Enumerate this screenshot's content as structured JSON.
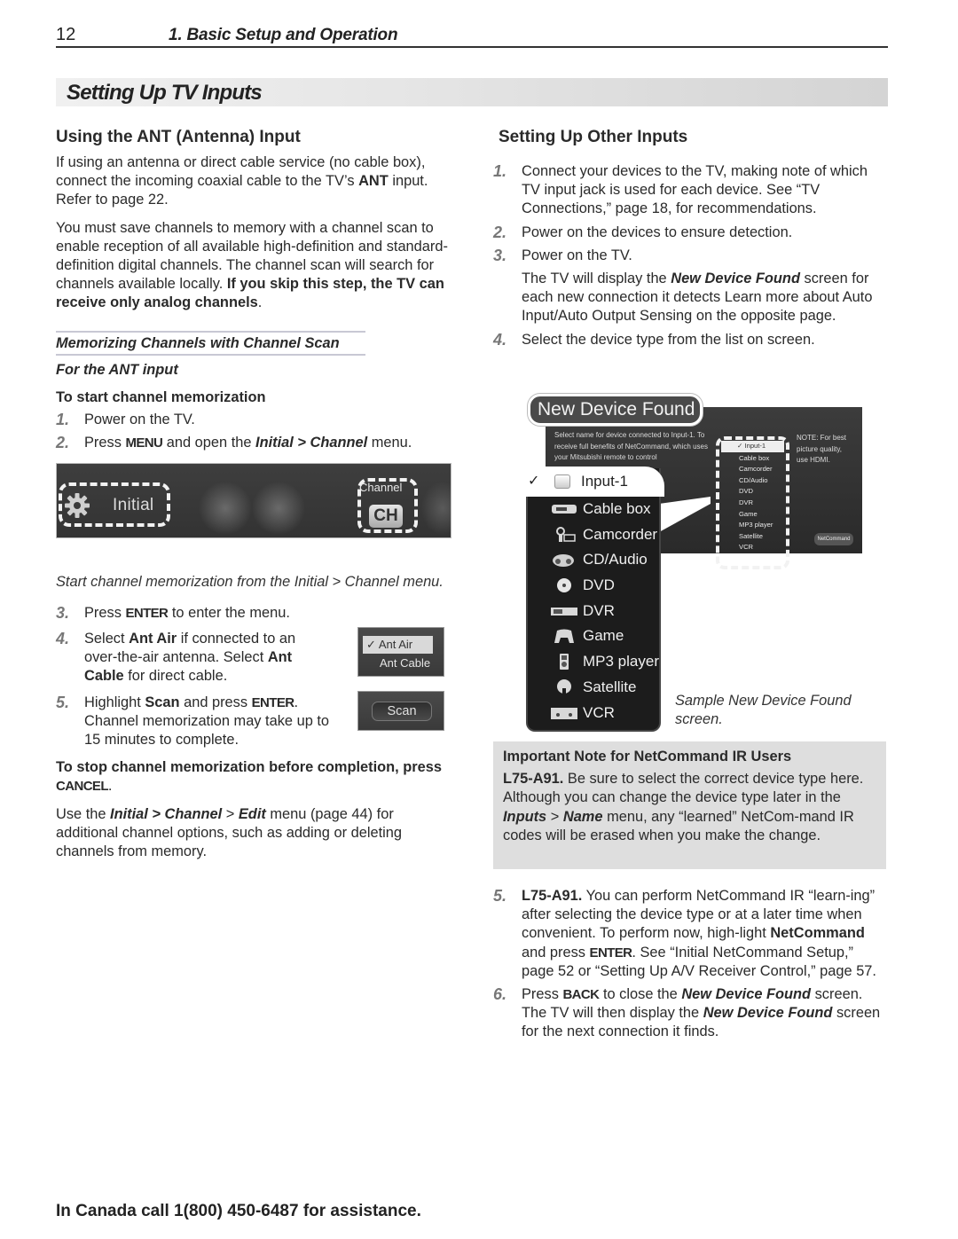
{
  "header": {
    "page_number": "12",
    "chapter": "1. Basic Setup and Operation"
  },
  "section_title": "Setting Up TV Inputs",
  "left": {
    "heading": "Using the ANT (Antenna) Input",
    "para1": {
      "pre": "If using an antenna or direct cable service (no cable box), connect the incoming coaxial cable to the TV’s ",
      "bold": "ANT",
      "post": " input.  Refer to page 22."
    },
    "para2": {
      "pre": "You must save channels to memory with a channel scan to enable reception of all available high-definition and standard-definition digital channels.  The channel  scan will search for channels available locally.  ",
      "bold": "If you skip this step, the TV can receive only analog channels",
      "post": "."
    },
    "ruled_heading": "Memorizing Channels with Channel Scan",
    "italic_heading": "For the ANT input",
    "bold_heading": "To start channel memorization",
    "steps": [
      {
        "num": "1.",
        "text": "Power on the TV."
      },
      {
        "num": "2.",
        "pre": "Press ",
        "key": "MENU",
        "mid": " and open the ",
        "bi": "Initial > Channel",
        "post": " menu."
      },
      {
        "num": "3.",
        "pre": "Press ",
        "key": "ENTER",
        "post": " to enter the menu."
      },
      {
        "num": "4.",
        "pre": "Select ",
        "b1": "Ant Air",
        "mid": " if connected to an over-the-air antenna.  Select ",
        "b2": "Ant Cable",
        "post": " for direct cable."
      },
      {
        "num": "5.",
        "pre": "Highlight ",
        "b1": "Scan",
        "mid": " and press ",
        "key": "ENTER",
        "post": ".  Channel memorization may take up to 15 minutes to complete."
      }
    ],
    "tv_menu": {
      "initial_label": "Initial",
      "channel_label": "Channel",
      "ch_icon": "CH"
    },
    "menu_caption": "Start channel memorization from the Initial > Channel menu.",
    "ant_options": {
      "selected": "Ant Air",
      "other": "Ant Cable",
      "check": "✓"
    },
    "scan_button": "Scan",
    "stop_note": {
      "bold": "To stop channel memorization before completion, press ",
      "key": "CANCEL",
      "post": "."
    },
    "edit_para": {
      "pre": "Use the ",
      "bi1": "Initial > Channel",
      "sep": " > ",
      "bi2": "Edit",
      "post": " menu (page 44) for additional channel options, such as adding or deleting channels from memory."
    }
  },
  "right": {
    "heading": "Setting Up Other Inputs",
    "steps": [
      {
        "num": "1.",
        "text": "Connect your devices to the TV, making note of which TV input jack is used for each device.  See “TV Connections,” page 18, for recommendations."
      },
      {
        "num": "2.",
        "text": "Power on the devices to ensure detection."
      },
      {
        "num": "3.",
        "text": "Power on the TV.",
        "after_pre": "The TV will display the ",
        "after_bi": "New Device Found",
        "after_post": " screen for each new connection it detects  Learn more about Auto Input/Auto Output Sensing on the opposite page."
      },
      {
        "num": "4.",
        "text": "Select the device type from the list on screen."
      }
    ],
    "ndf_screen": {
      "tab_title": "New Device Found",
      "description": "Select name for device connected to Input-1. To receive full benefits of NetCommand, which uses your Mitsubishi remote to control",
      "note": "NOTE: For best picture quality, use HDMI.",
      "netcommand_button": "NetCommand",
      "selected_device": "Input-1",
      "devices": [
        "Cable box",
        "Camcorder",
        "CD/Audio",
        "DVD",
        "DVR",
        "Game",
        "MP3 player",
        "Satellite",
        "VCR"
      ],
      "check": "✓"
    },
    "ndf_caption": "Sample New Device Found screen.",
    "note_box": {
      "title": "Important Note for NetCommand IR Users",
      "model": "L75-A91.",
      "pre": "  Be sure to select the correct device type here.  Although you can change the device type later in the ",
      "bi1": "Inputs",
      "sep": " > ",
      "bi2": "Name",
      "post": " menu, any “learned” NetCom-mand IR codes will be erased when you make the change."
    },
    "steps_lower": [
      {
        "num": "5.",
        "model": "L75-A91.",
        "pre": "  You can perform NetCommand IR “learn-ing” after selecting the device type or at a later time when convenient.  To perform now, high-light ",
        "b": "NetCommand",
        "mid": " and press ",
        "key": "ENTER",
        "post": ".  See “Initial NetCommand Setup,” page 52 or “Setting Up A/V Receiver Control,” page 57."
      },
      {
        "num": "6.",
        "pre": "Press ",
        "key": "BACK",
        "mid": " to close the ",
        "bi1": "New Device Found",
        "mid2": " screen. The TV will then display the ",
        "bi2": "New Device Found",
        "post": " screen for the next connection it finds."
      }
    ]
  },
  "footer": "In Canada call 1(800) 450-6487 for assistance."
}
